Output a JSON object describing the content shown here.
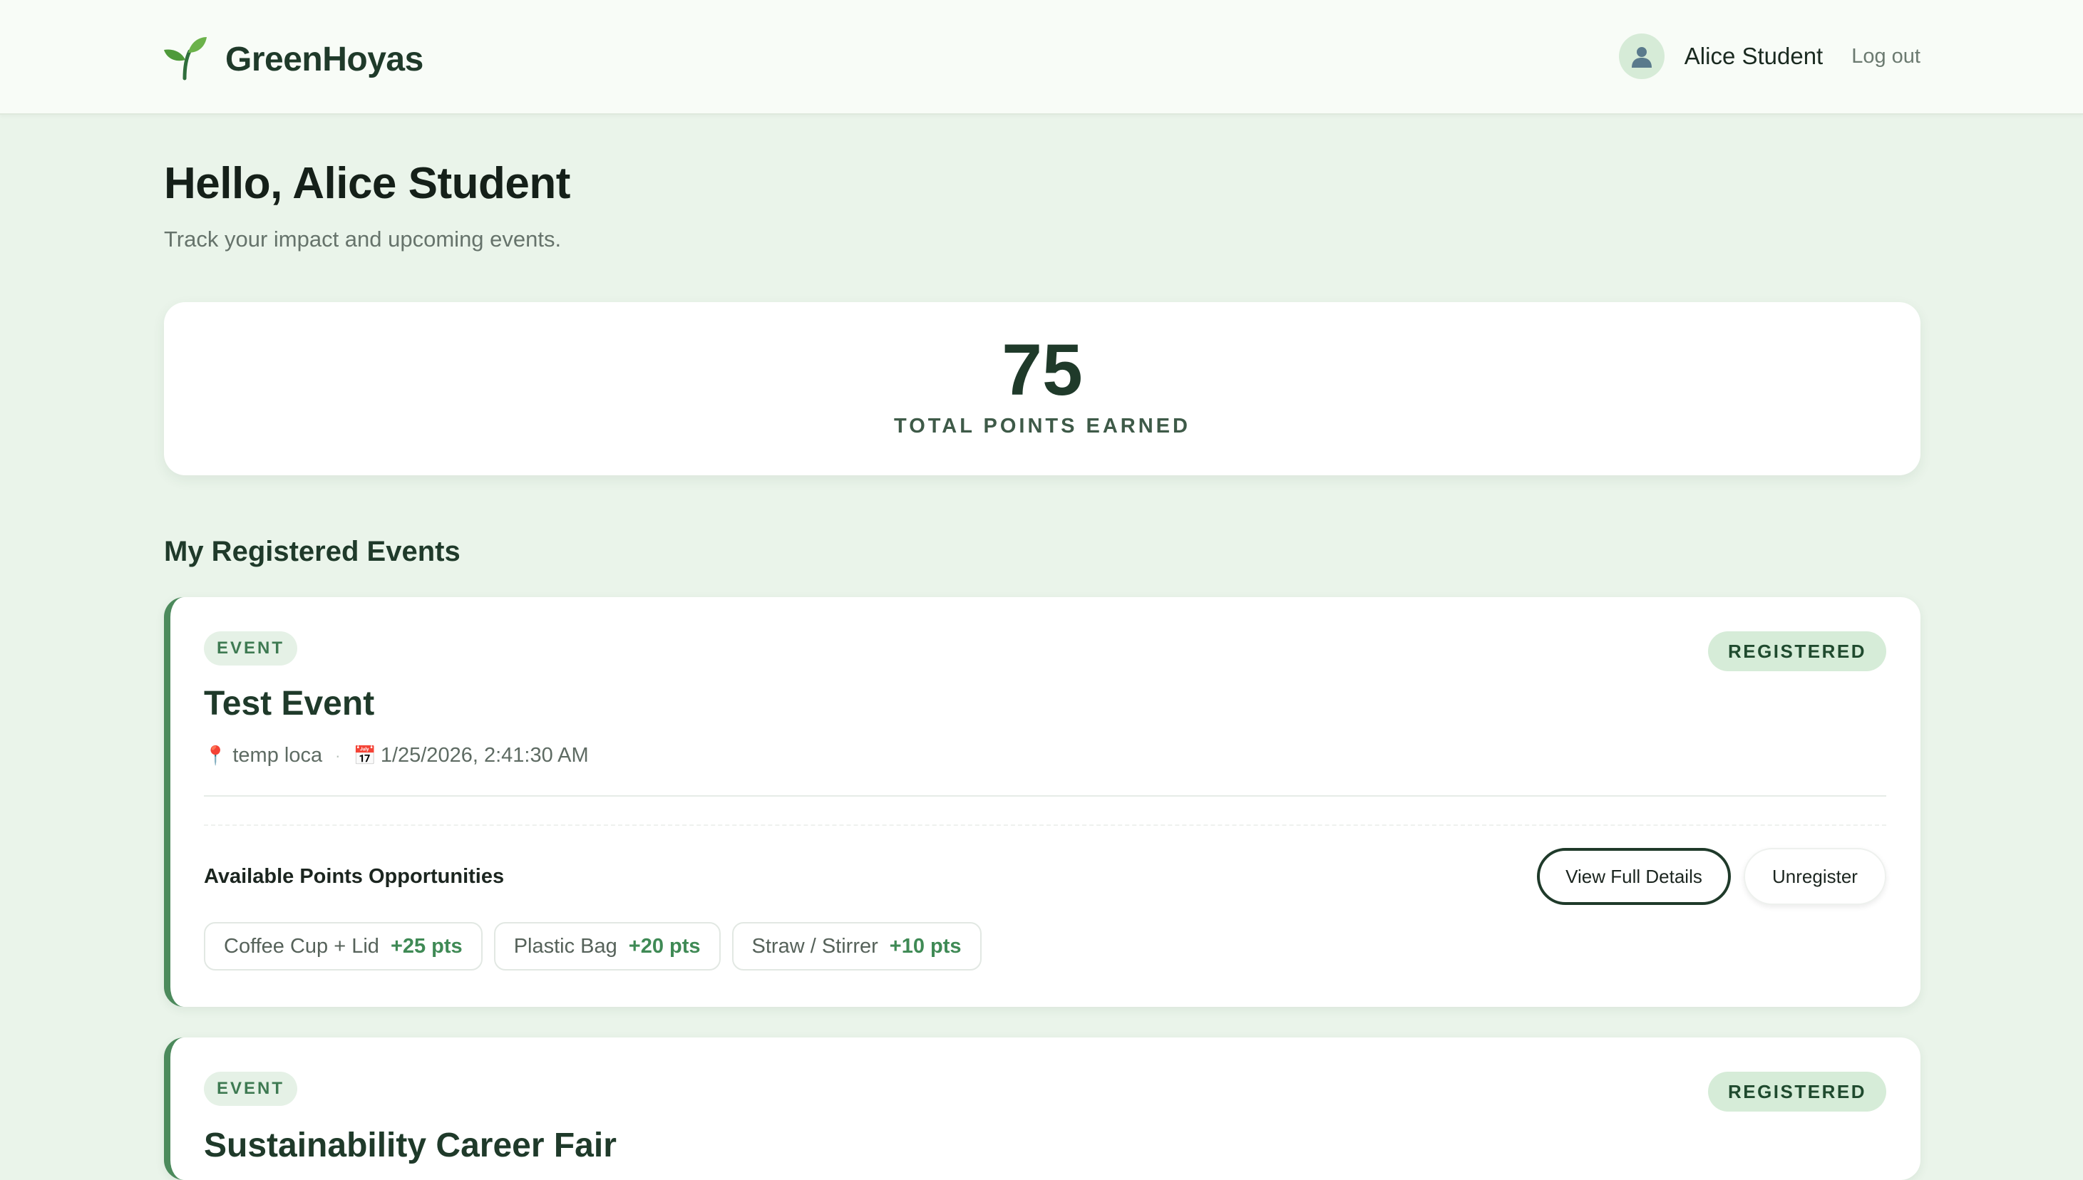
{
  "header": {
    "brand": "GreenHoyas",
    "user_name": "Alice Student",
    "logout_label": "Log out"
  },
  "greeting": {
    "title": "Hello, Alice Student",
    "subtitle": "Track your impact and upcoming events."
  },
  "points": {
    "value": "75",
    "label": "TOTAL POINTS EARNED"
  },
  "section_title": "My Registered Events",
  "events": [
    {
      "type": "EVENT",
      "status": "REGISTERED",
      "title": "Test Event",
      "location": "temp loca",
      "datetime": "1/25/2026, 2:41:30 AM",
      "opportunities_title": "Available Points Opportunities",
      "view_label": "View Full Details",
      "unregister_label": "Unregister",
      "opportunities": [
        {
          "name": "Coffee Cup + Lid",
          "points": "+25 pts"
        },
        {
          "name": "Plastic Bag",
          "points": "+20 pts"
        },
        {
          "name": "Straw / Stirrer",
          "points": "+10 pts"
        }
      ]
    },
    {
      "type": "EVENT",
      "status": "REGISTERED",
      "title": "Sustainability Career Fair"
    }
  ],
  "colors": {
    "accent": "#4c8a5c",
    "background": "#eaf4ea",
    "points_text": "#3f8a55"
  }
}
